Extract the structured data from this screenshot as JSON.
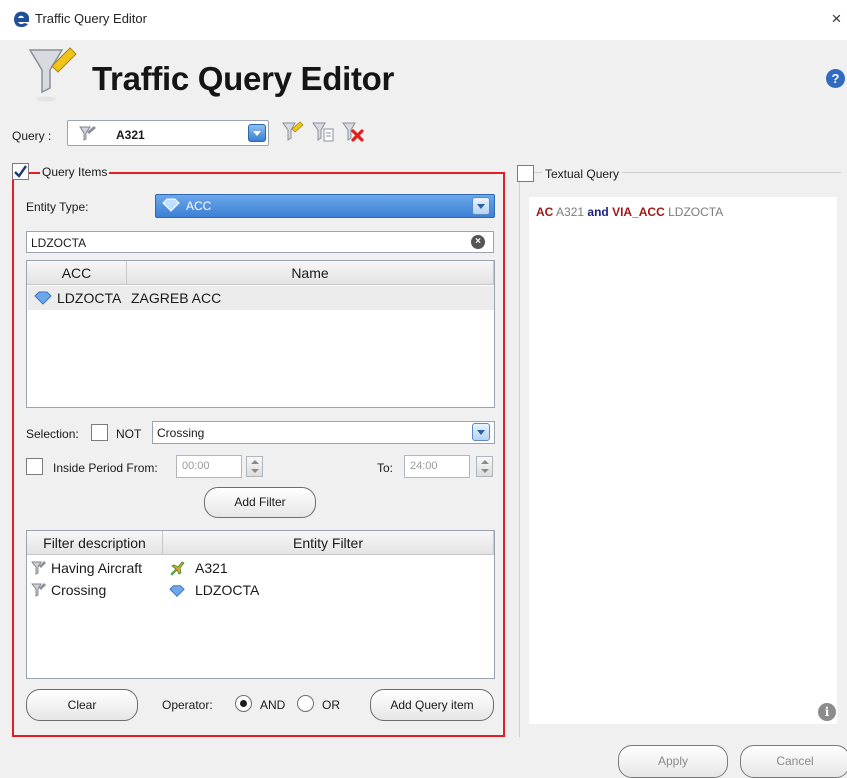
{
  "window": {
    "title": "Traffic Query Editor",
    "close_glyph": "×",
    "app_icon": "e-logo-icon"
  },
  "header": {
    "title": "Traffic Query Editor",
    "icon": "filter-funnel-icon",
    "help_glyph": "?"
  },
  "query": {
    "label": "Query :",
    "selected": "A321",
    "tools": [
      "new-filter-icon",
      "copy-filter-icon",
      "delete-filter-icon"
    ]
  },
  "query_items": {
    "label": "Query Items",
    "checked": true,
    "entity_type_label": "Entity Type:",
    "entity_type_value": "ACC",
    "search_value": "LDZOCTA",
    "entity_table": {
      "columns": [
        "ACC",
        "Name"
      ],
      "rows": [
        {
          "acc": "LDZOCTA",
          "name": "ZAGREB ACC"
        }
      ]
    },
    "selection_label": "Selection:",
    "not_label": "NOT",
    "selection_value": "Crossing",
    "inside_period_label": "Inside Period From:",
    "from_value": "00:00",
    "to_label": "To:",
    "to_value": "24:00",
    "add_filter_label": "Add Filter",
    "filter_table": {
      "columns": [
        "Filter description",
        "Entity Filter"
      ],
      "rows": [
        {
          "description": "Having Aircraft",
          "entity": "A321",
          "entity_icon": "aircraft-icon"
        },
        {
          "description": "Crossing",
          "entity": "LDZOCTA",
          "entity_icon": "acc-sector-icon"
        }
      ]
    },
    "clear_label": "Clear",
    "operator_label": "Operator:",
    "operator_and": "AND",
    "operator_or": "OR",
    "operator_selected": "AND",
    "add_query_item_label": "Add Query item"
  },
  "textual_query": {
    "label": "Textual Query",
    "checked": false,
    "kw_ac": "AC",
    "val_ac": "A321",
    "kw_and": "and",
    "kw_via": "VIA_ACC",
    "val_via": "LDZOCTA",
    "info_glyph": "i"
  },
  "footer": {
    "apply_label": "Apply",
    "cancel_label": "Cancel"
  },
  "colors": {
    "accent_blue": "#3d7fd6",
    "highlight_red": "#e41e26",
    "keyword_red": "#9b1a1a",
    "keyword_navy": "#1b1f86"
  }
}
